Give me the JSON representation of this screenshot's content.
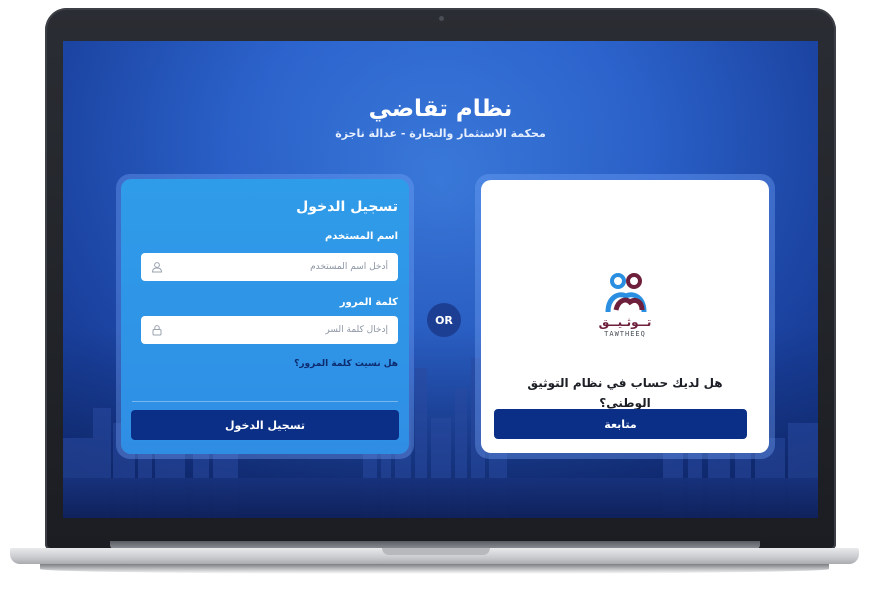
{
  "header": {
    "title": "نظام تقاضي",
    "subtitle": "محكمة الاستثمار والتجارة - عدالة ناجزة"
  },
  "login": {
    "heading": "تسجيل الدخول",
    "username_label": "اسم المستخدم",
    "username_placeholder": "أدخل اسم المستخدم",
    "password_label": "كلمة المرور",
    "password_placeholder": "إدخال كلمة السر",
    "forgot_link": "هل نسيت كلمة المرور؟",
    "submit_label": "تسجيل الدخول"
  },
  "separator": {
    "label": "OR"
  },
  "tawtheeq": {
    "logo_text_arabic": "تــوثـيــق",
    "logo_text_latin": "TAWTHEEQ",
    "question": "هل لديك حساب في نظام التوثيق الوطني؟",
    "continue_label": "متابعة"
  },
  "colors": {
    "primary": "#0b2e86",
    "login_card": "#2f8ee4",
    "background": "#2c64cd",
    "brand_maroon": "#6d1f3b"
  },
  "icons": {
    "username": "user-icon",
    "password": "lock-icon",
    "logo": "tawtheeq-logo-icon"
  }
}
